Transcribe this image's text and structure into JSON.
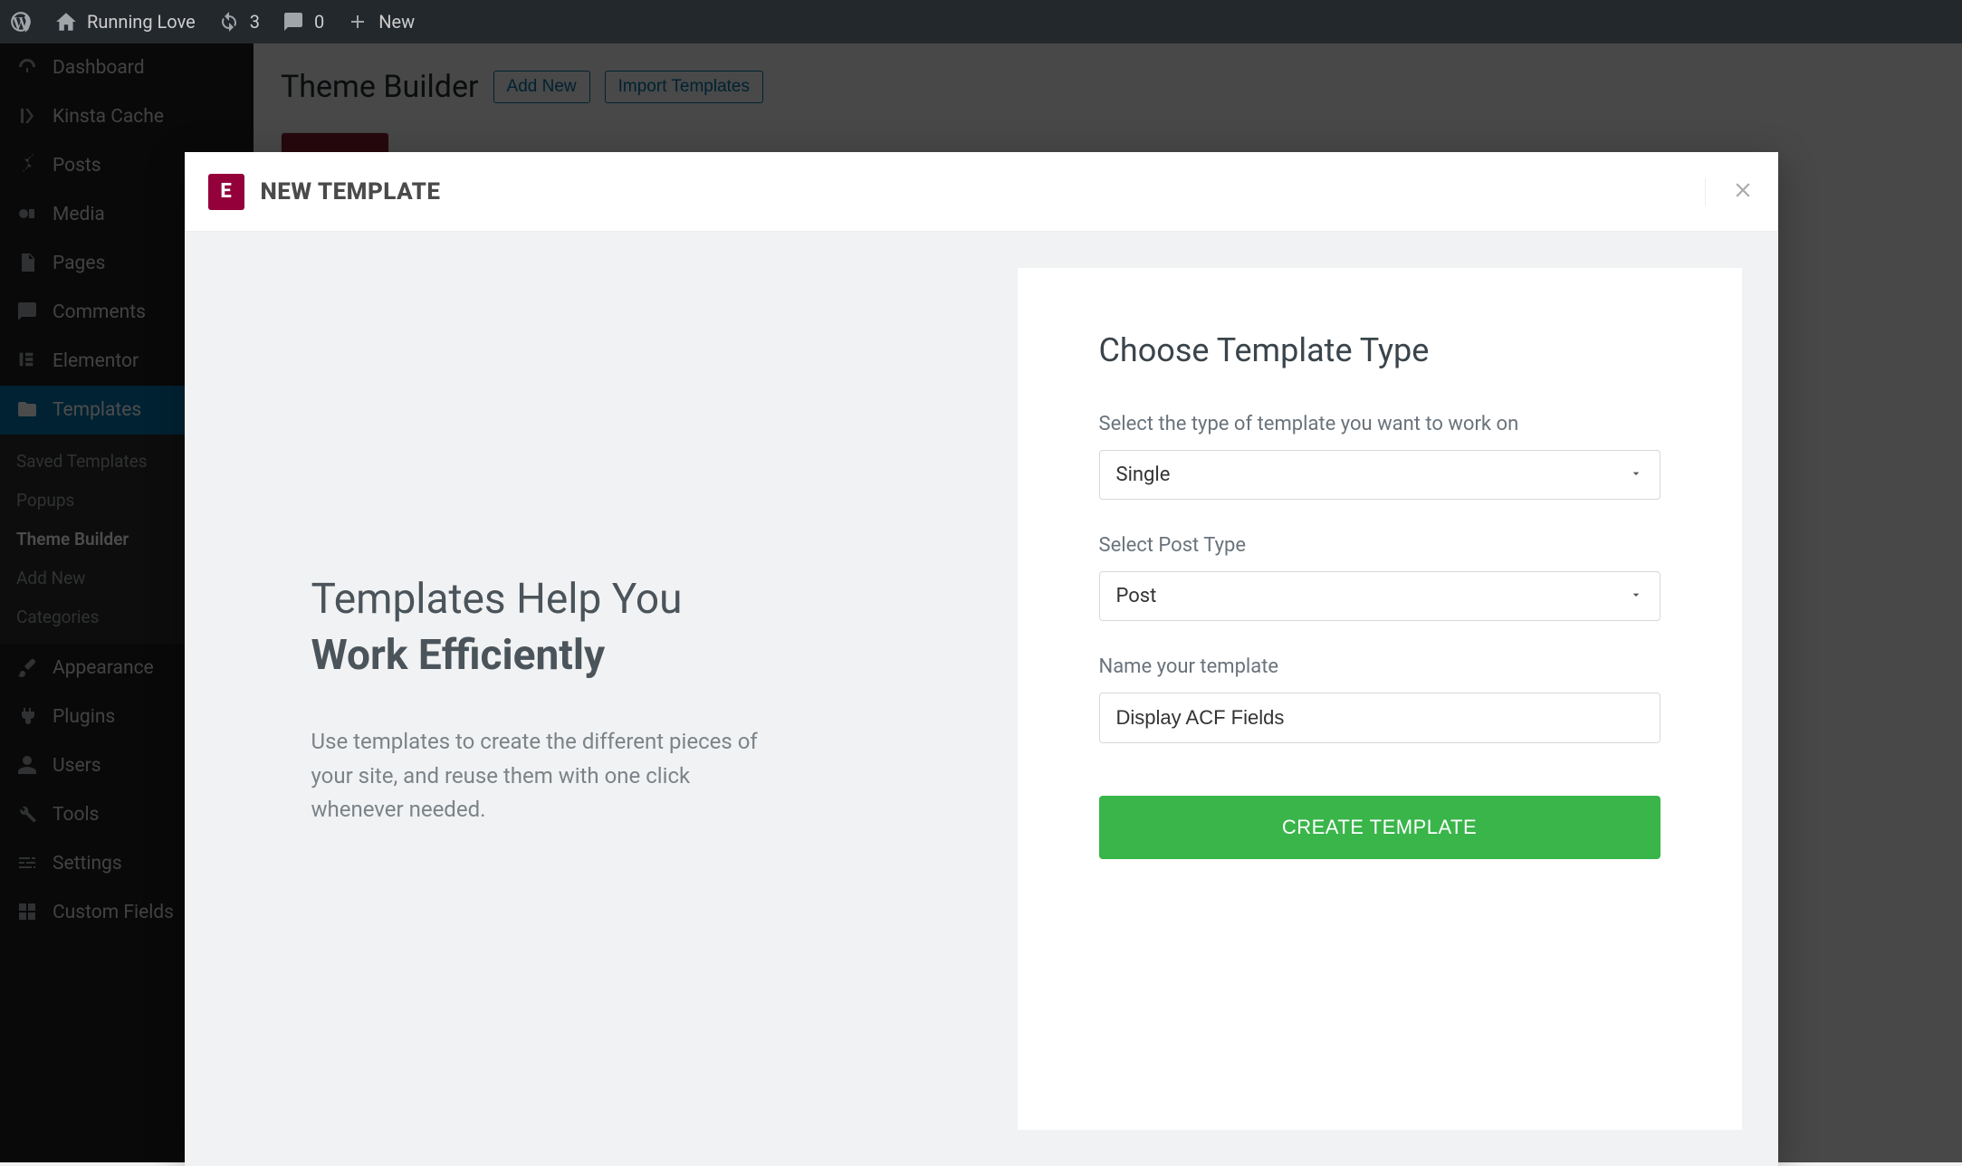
{
  "adminbar": {
    "site_name": "Running Love",
    "updates_count": "3",
    "comments_count": "0",
    "new_label": "New"
  },
  "sidebar": {
    "items": [
      {
        "label": "Dashboard",
        "icon": "dashboard"
      },
      {
        "label": "Kinsta Cache",
        "icon": "kinsta"
      },
      {
        "label": "Posts",
        "icon": "pin"
      },
      {
        "label": "Media",
        "icon": "media"
      },
      {
        "label": "Pages",
        "icon": "page"
      },
      {
        "label": "Comments",
        "icon": "comment"
      },
      {
        "label": "Elementor",
        "icon": "elementor"
      },
      {
        "label": "Templates",
        "icon": "folder",
        "active": true
      },
      {
        "label": "Appearance",
        "icon": "brush"
      },
      {
        "label": "Plugins",
        "icon": "plug"
      },
      {
        "label": "Users",
        "icon": "user"
      },
      {
        "label": "Tools",
        "icon": "wrench"
      },
      {
        "label": "Settings",
        "icon": "sliders"
      },
      {
        "label": "Custom Fields",
        "icon": "grid"
      }
    ],
    "submenu": [
      {
        "label": "Saved Templates"
      },
      {
        "label": "Popups"
      },
      {
        "label": "Theme Builder",
        "active": true
      },
      {
        "label": "Add New"
      },
      {
        "label": "Categories"
      }
    ]
  },
  "page": {
    "title": "Theme Builder",
    "add_new": "Add New",
    "import": "Import Templates"
  },
  "modal": {
    "title": "NEW TEMPLATE",
    "left": {
      "headline_line1": "Templates Help You",
      "headline_line2": "Work Efficiently",
      "description": "Use templates to create the different pieces of your site, and reuse them with one click whenever needed."
    },
    "form": {
      "title": "Choose Template Type",
      "field1_label": "Select the type of template you want to work on",
      "field1_value": "Single",
      "field2_label": "Select Post Type",
      "field2_value": "Post",
      "field3_label": "Name your template",
      "field3_value": "Display ACF Fields",
      "submit": "CREATE TEMPLATE"
    }
  }
}
